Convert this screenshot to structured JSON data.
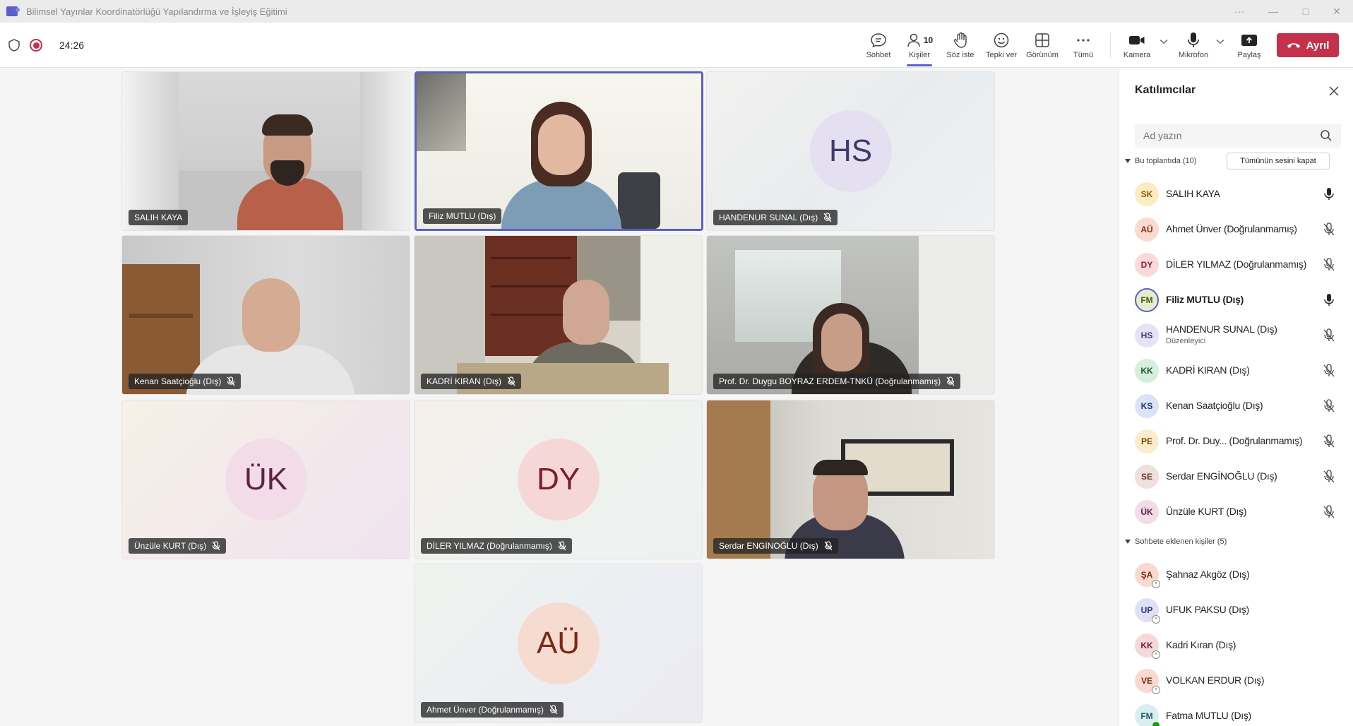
{
  "window": {
    "title": "Bilimsel Yayınlar Koordinatörlüğü Yapılandırma ve İşleyiş Eğitimi",
    "more": "···",
    "minimize": "—",
    "maximize": "□",
    "close": "✕"
  },
  "toolbar": {
    "timer": "24:26",
    "chat": "Sohbet",
    "people": "Kişiler",
    "people_count": "10",
    "raise": "Söz iste",
    "react": "Tepki ver",
    "view": "Görünüm",
    "more": "Tümü",
    "camera": "Kamera",
    "mic": "Mikrofon",
    "share": "Paylaş",
    "leave": "Ayrıl"
  },
  "tiles": [
    {
      "name": "SALIH KAYA",
      "type": "video",
      "muted": false
    },
    {
      "name": "Filiz MUTLU (Dış)",
      "type": "video",
      "muted": false,
      "speaking": true
    },
    {
      "name": "HANDENUR SUNAL (Dış)",
      "type": "avatar",
      "initials": "HS",
      "muted": true
    },
    {
      "name": "Kenan Saatçioğlu (Dış)",
      "type": "video",
      "muted": true
    },
    {
      "name": "KADRİ KIRAN (Dış)",
      "type": "video",
      "muted": true
    },
    {
      "name": "Prof. Dr. Duygu BOYRAZ ERDEM-TNKÜ (Doğrulanmamış)",
      "type": "video",
      "muted": true
    },
    {
      "name": "Ünzüle KURT (Dış)",
      "type": "avatar",
      "initials": "ÜK",
      "muted": true
    },
    {
      "name": "DİLER YILMAZ (Doğrulanmamış)",
      "type": "avatar",
      "initials": "DY",
      "muted": true
    },
    {
      "name": "Serdar ENGİNOĞLU (Dış)",
      "type": "video",
      "muted": true
    },
    {
      "name": "Ahmet Ünver (Doğrulanmamış)",
      "type": "avatar",
      "initials": "AÜ",
      "muted": true
    }
  ],
  "panel": {
    "title": "Katılımcılar",
    "search_placeholder": "Ad yazın",
    "in_meeting": "Bu toplantıda (10)",
    "mute_all": "Tümünün sesini kapat",
    "in_chat": "Sohbete eklenen kişiler (5)",
    "participants": [
      {
        "initials": "SK",
        "name": "SALIH KAYA",
        "muted": false
      },
      {
        "initials": "AÜ",
        "name": "Ahmet Ünver (Doğrulanmamış)",
        "muted": true
      },
      {
        "initials": "DY",
        "name": "DİLER YILMAZ (Doğrulanmamış)",
        "muted": true
      },
      {
        "initials": "FM",
        "name": "Filiz MUTLU (Dış)",
        "muted": false,
        "speaking": true
      },
      {
        "initials": "HS",
        "name": "HANDENUR SUNAL (Dış)",
        "role": "Düzenleyici",
        "muted": true
      },
      {
        "initials": "KK",
        "name": "KADRİ KIRAN (Dış)",
        "muted": true
      },
      {
        "initials": "KS",
        "name": "Kenan Saatçioğlu (Dış)",
        "muted": true
      },
      {
        "initials": "PE",
        "name": "Prof. Dr. Duy...  (Doğrulanmamış)",
        "muted": true
      },
      {
        "initials": "SE",
        "name": "Serdar ENGİNOĞLU (Dış)",
        "muted": true
      },
      {
        "initials": "ÜK",
        "name": "Ünzüle KURT (Dış)",
        "muted": true
      }
    ],
    "chat_people": [
      {
        "initials": "ŞA",
        "name": "Şahnaz Akgöz (Dış)"
      },
      {
        "initials": "UP",
        "name": "UFUK PAKSU (Dış)"
      },
      {
        "initials": "KK",
        "name": "Kadri Kıran (Dış)"
      },
      {
        "initials": "VE",
        "name": "VOLKAN ERDUR (Dış)"
      },
      {
        "initials": "FM",
        "name": "Fatma MUTLU (Dış)"
      }
    ]
  },
  "colors": {
    "accent": "#5b5fc7",
    "leave": "#c4314b"
  }
}
